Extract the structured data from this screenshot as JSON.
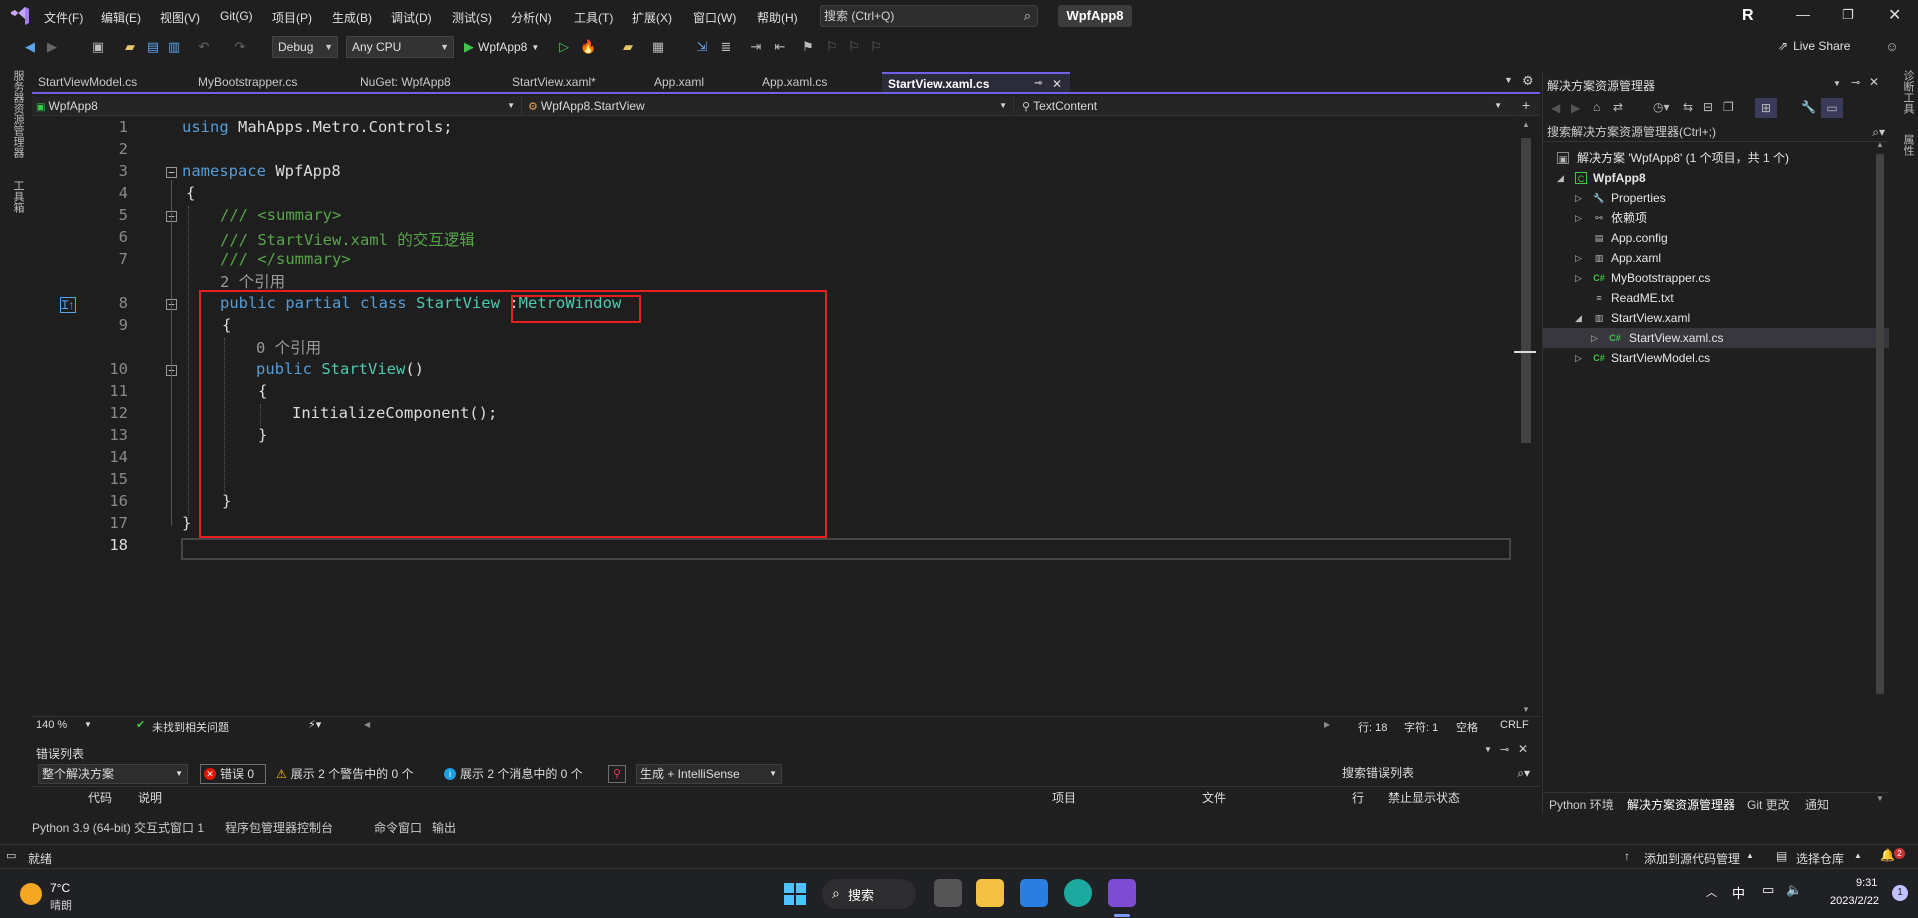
{
  "menu": {
    "items": [
      "文件(F)",
      "编辑(E)",
      "视图(V)",
      "Git(G)",
      "项目(P)",
      "生成(B)",
      "调试(D)",
      "测试(S)",
      "分析(N)",
      "工具(T)",
      "扩展(X)",
      "窗口(W)",
      "帮助(H)"
    ],
    "search_placeholder": "搜索 (Ctrl+Q)",
    "project_badge": "WpfApp8",
    "avatar_letter": "R"
  },
  "toolbar": {
    "config": "Debug",
    "platform": "Any CPU",
    "run_target": "WpfApp8",
    "live_share": "Live Share"
  },
  "left_strip": {
    "server_explorer": "服务器资源管理器",
    "toolbox": "工具箱"
  },
  "tabs": [
    {
      "label": "StartViewModel.cs",
      "active": false
    },
    {
      "label": "MyBootstrapper.cs",
      "active": false
    },
    {
      "label": "NuGet: WpfApp8",
      "active": false
    },
    {
      "label": "StartView.xaml*",
      "active": false
    },
    {
      "label": "App.xaml",
      "active": false
    },
    {
      "label": "App.xaml.cs",
      "active": false
    },
    {
      "label": "StartView.xaml.cs",
      "active": true
    }
  ],
  "navbar": {
    "project": "WpfApp8",
    "type": "WpfApp8.StartView",
    "member": "TextContent"
  },
  "code": {
    "l1_kw": "using",
    "l1_ns": " MahApps.Metro.Controls;",
    "l3_kw": "namespace",
    "l3_name": " WpfApp8",
    "brace_open": "{",
    "brace_close": "}",
    "l5": "/// <summary>",
    "l6": "/// StartView.xaml 的交互逻辑",
    "l7": "/// </summary>",
    "ref2": "2 个引用",
    "l8_kw": "public partial class",
    "l8_cls": "StartView",
    "l8_colon": " :",
    "l8_base": "MetroWindow",
    "ref0": "0 个引用",
    "l10_kw": "public",
    "l10_name": "StartView",
    "l10_paren": "()",
    "l12": "InitializeComponent();"
  },
  "line_numbers": [
    "1",
    "2",
    "3",
    "4",
    "5",
    "6",
    "7",
    "8",
    "9",
    "10",
    "11",
    "12",
    "13",
    "14",
    "15",
    "16",
    "17",
    "18"
  ],
  "editor_status": {
    "zoom": "140 %",
    "issues": "未找到相关问题",
    "line": "行: 18",
    "char": "字符: 1",
    "space": "空格",
    "eol": "CRLF"
  },
  "error_list": {
    "title": "错误列表",
    "scope": "整个解决方案",
    "errors": "错误 0",
    "warnings": "展示 2 个警告中的 0 个",
    "messages": "展示 2 个消息中的 0 个",
    "build_filter": "生成 + IntelliSense",
    "search_placeholder": "搜索错误列表",
    "columns": [
      "代码",
      "说明",
      "项目",
      "文件",
      "行",
      "禁止显示状态"
    ]
  },
  "bottom_tabs": [
    "Python 3.9 (64-bit) 交互式窗口 1",
    "程序包管理器控制台",
    "命令窗口",
    "输出"
  ],
  "solution_explorer": {
    "title": "解决方案资源管理器",
    "search_placeholder": "搜索解决方案资源管理器(Ctrl+;)",
    "solution_label": "解决方案 'WpfApp8' (1 个项目，共 1 个)",
    "project": "WpfApp8",
    "items": [
      {
        "label": "Properties"
      },
      {
        "label": "依赖项"
      },
      {
        "label": "App.config"
      },
      {
        "label": "App.xaml"
      },
      {
        "label": "MyBootstrapper.cs"
      },
      {
        "label": "ReadME.txt"
      },
      {
        "label": "StartView.xaml"
      },
      {
        "label": "StartView.xaml.cs"
      },
      {
        "label": "StartViewModel.cs"
      }
    ],
    "bottom_tabs": [
      "Python 环境",
      "解决方案资源管理器",
      "Git 更改",
      "通知"
    ]
  },
  "right_strip": {
    "diagnostics": "诊断工具",
    "properties": "属性"
  },
  "status": {
    "ready": "就绪",
    "source_control": "添加到源代码管理",
    "repo": "选择仓库",
    "notif_count": "2"
  },
  "taskbar": {
    "temp": "7°C",
    "weather": "晴朗",
    "search": "搜索",
    "ime": "中",
    "time": "9:31",
    "date": "2023/2/22",
    "badge": "1"
  },
  "colors": {
    "accent": "#7160e8",
    "highlight_box": "#e81e1e",
    "keyword": "#569cd6",
    "type": "#4ec9b0",
    "comment": "#57a64a"
  }
}
